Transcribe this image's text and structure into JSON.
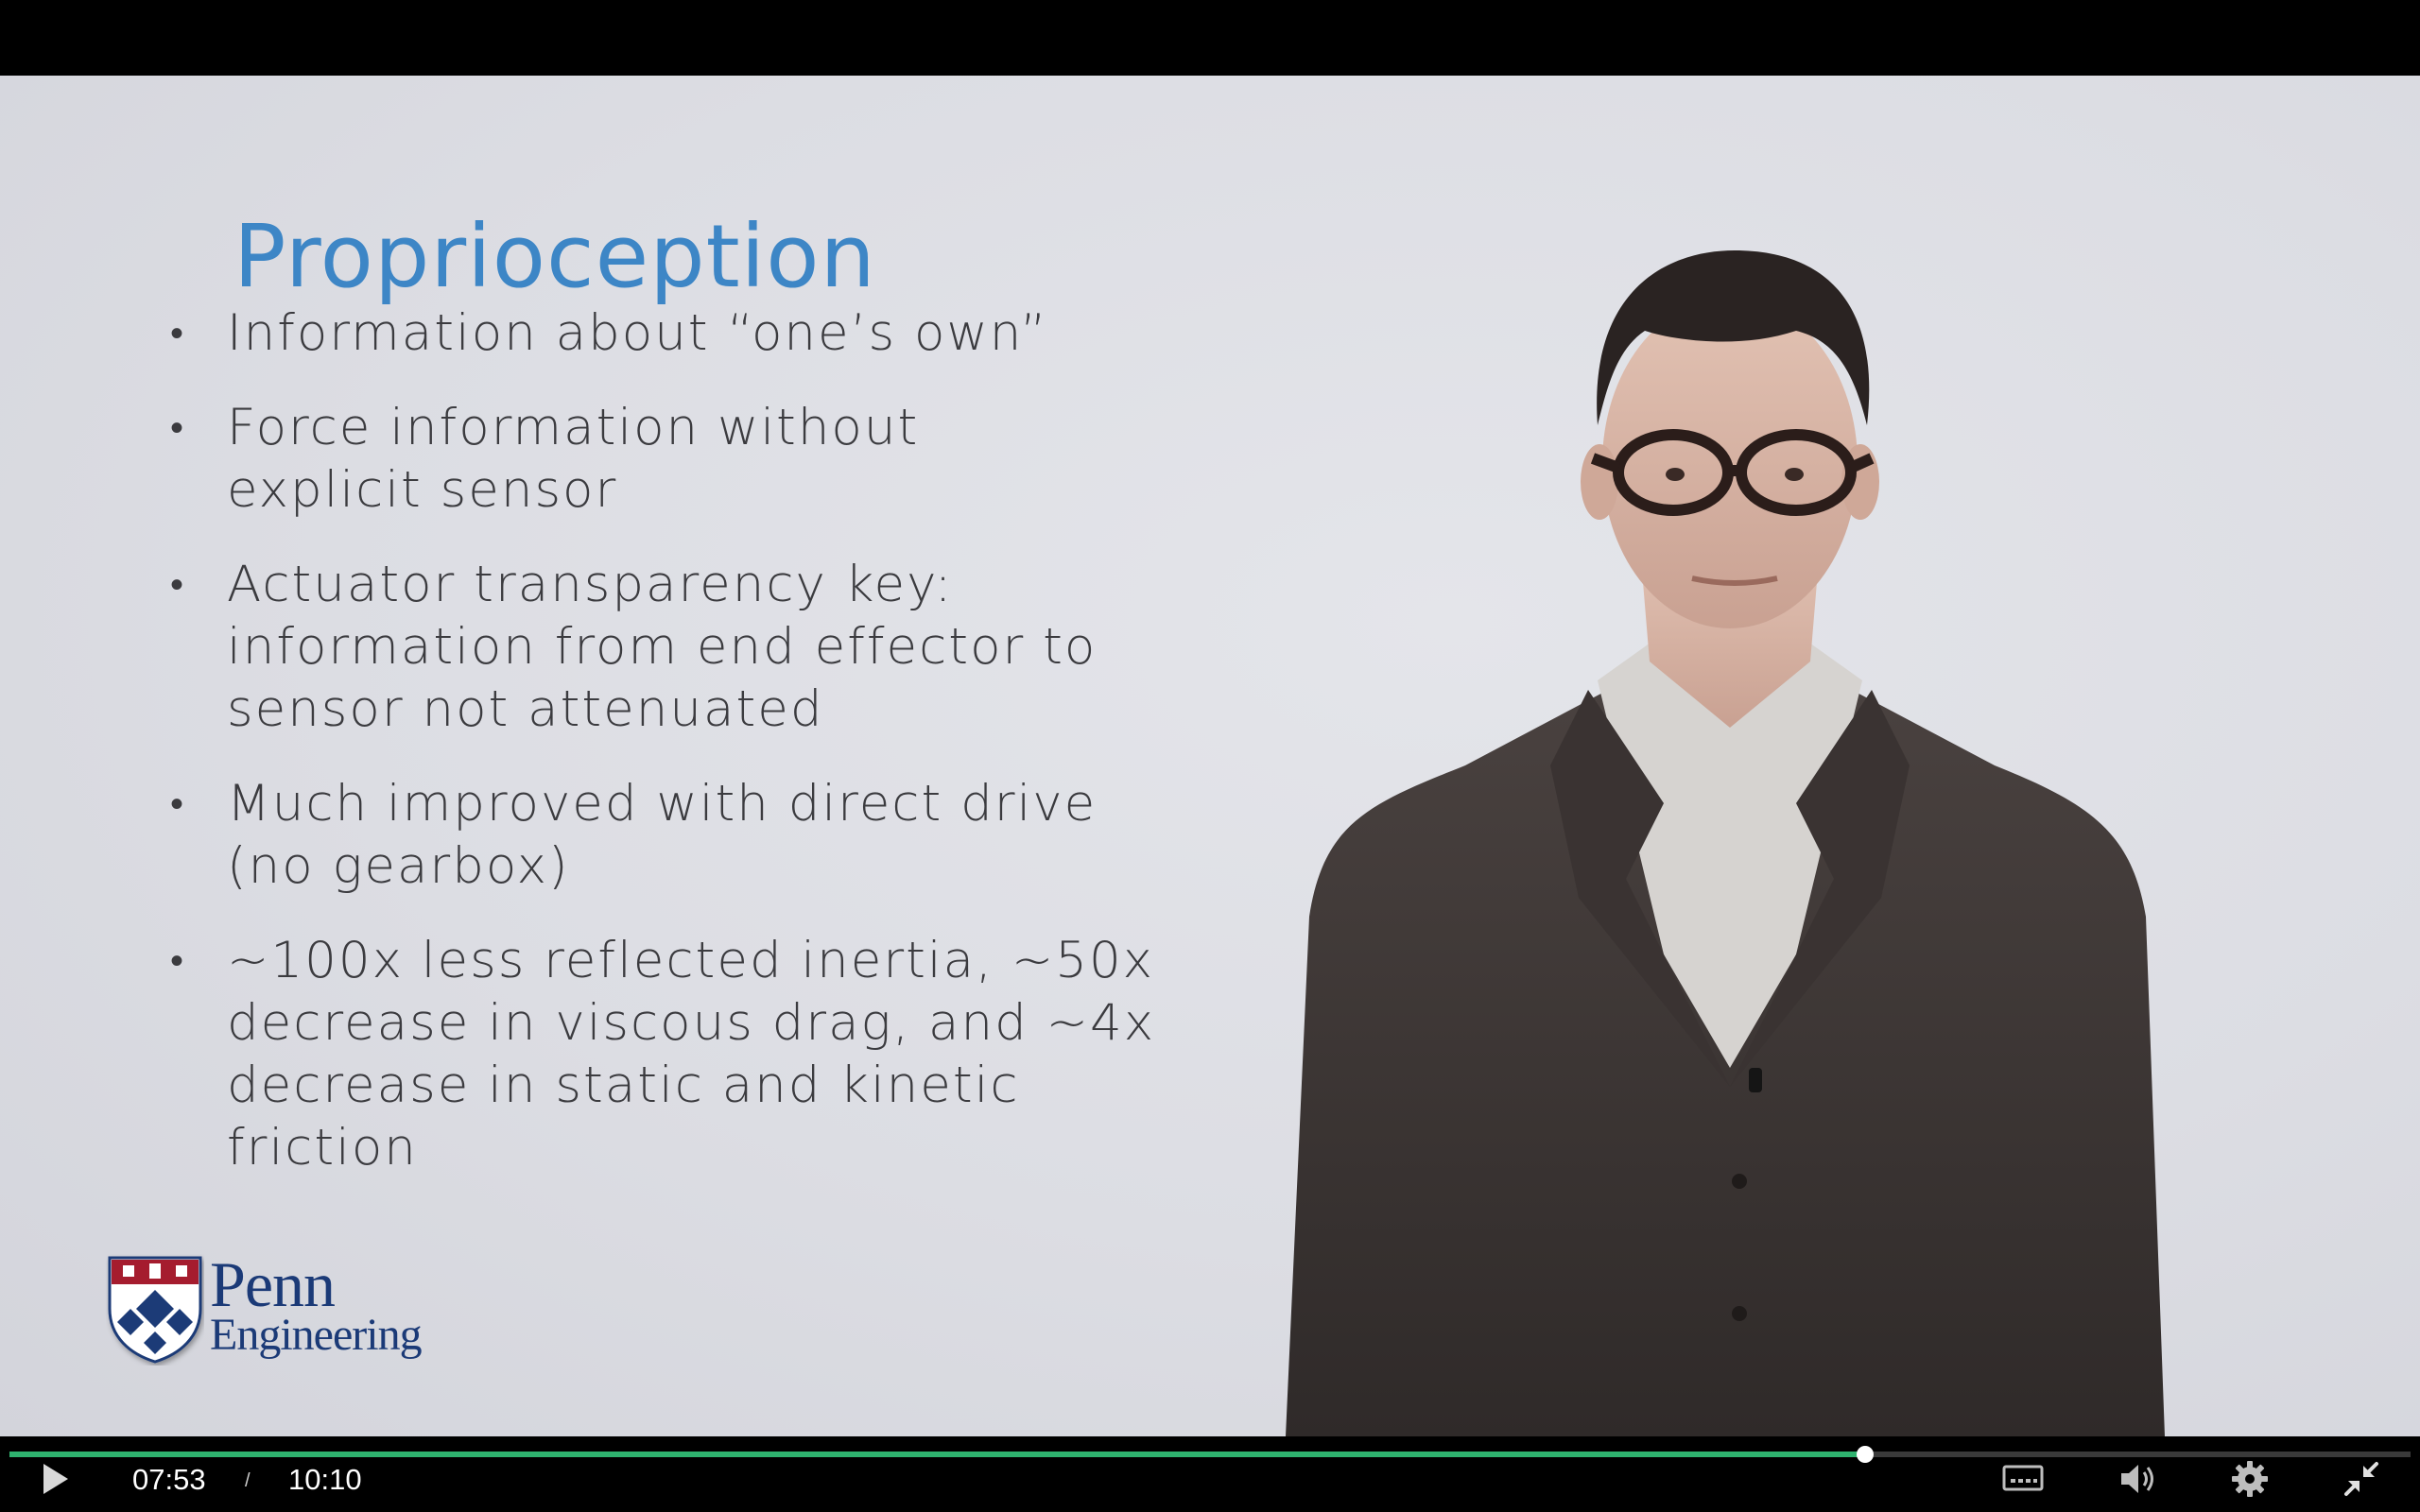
{
  "slide": {
    "title": "Proprioception",
    "bullets": [
      {
        "lines": [
          "Information about “one’s own”"
        ]
      },
      {
        "lines": [
          "Force information without",
          "explicit sensor"
        ]
      },
      {
        "lines": [
          "Actuator transparency key:",
          "information from end effector to",
          "sensor not attenuated"
        ]
      },
      {
        "lines": [
          "Much improved with direct drive",
          "(no gearbox)"
        ]
      },
      {
        "lines": [
          "~100x less reflected inertia, ~50x",
          "decrease in viscous drag, and ~4x",
          "decrease in static and kinetic",
          "friction"
        ]
      }
    ],
    "bullet_marker": "•"
  },
  "logo": {
    "line1": "Penn",
    "line2": "Engineering",
    "color": "#1b3a77",
    "shield_red": "#a51f2d"
  },
  "player": {
    "current_time": "07:53",
    "separator": "/",
    "duration": "10:10",
    "progress": 0.773,
    "progress_color": "#2fb36f",
    "icons": {
      "play": "play-icon",
      "captions": "captions-icon",
      "volume": "volume-icon",
      "settings": "gear-icon",
      "exit_fullscreen": "exit-fullscreen-icon"
    }
  },
  "colors": {
    "title_blue": "#3d86c6",
    "text_gray": "#3b3b3f",
    "slide_background": "#dcdde3"
  }
}
